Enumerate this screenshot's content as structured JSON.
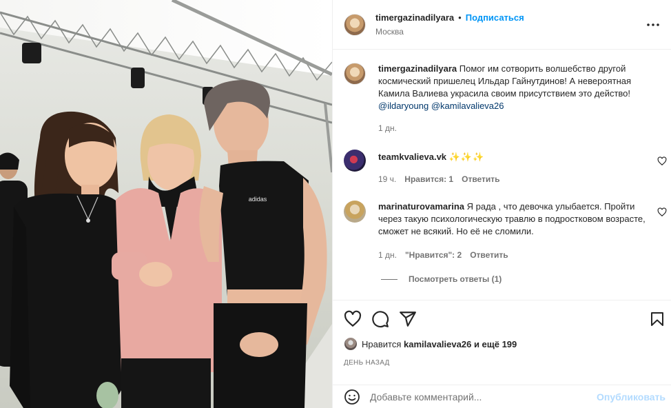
{
  "header": {
    "username": "timergazinadilyara",
    "separator": "•",
    "follow_label": "Подписаться",
    "location": "Москва"
  },
  "comments": [
    {
      "username": "timergazinadilyara",
      "text": "Помог им сотворить волшебство другой космический пришелец Ильдар Гайнутдинов! А невероятная Камила Валиева украсила своим присутствием это действо!",
      "mentions": [
        "@ildaryoung",
        "@kamilavalieva26"
      ],
      "time": "1 дн."
    },
    {
      "username": "teamkvalieva.vk",
      "text": "✨✨✨",
      "time": "19 ч.",
      "likes": "Нравится: 1",
      "reply_label": "Ответить"
    },
    {
      "username": "marinaturovamarina",
      "text": "Я рада , что девочка улыбается. Пройти через такую психологическую травлю в подростковом возрасте, сможет не всякий. Но её не сломили.",
      "time": "1 дн.",
      "likes": "\"Нравится\": 2",
      "reply_label": "Ответить",
      "view_replies": "Посмотреть ответы (1)"
    }
  ],
  "likes": {
    "prefix": "Нравится",
    "user": "kamilavalieva26",
    "suffix": "и ещё 199"
  },
  "date": "День назад",
  "add_comment": {
    "placeholder": "Добавьте комментарий...",
    "publish_label": "Опубликовать"
  },
  "colors": {
    "accent": "#0095f6",
    "publish_disabled": "#b3dbff",
    "mention": "#00376b",
    "secondary_text": "#737373"
  },
  "icons": [
    "more-icon",
    "heart-icon",
    "comment-icon",
    "share-icon",
    "save-icon",
    "smile-icon"
  ]
}
